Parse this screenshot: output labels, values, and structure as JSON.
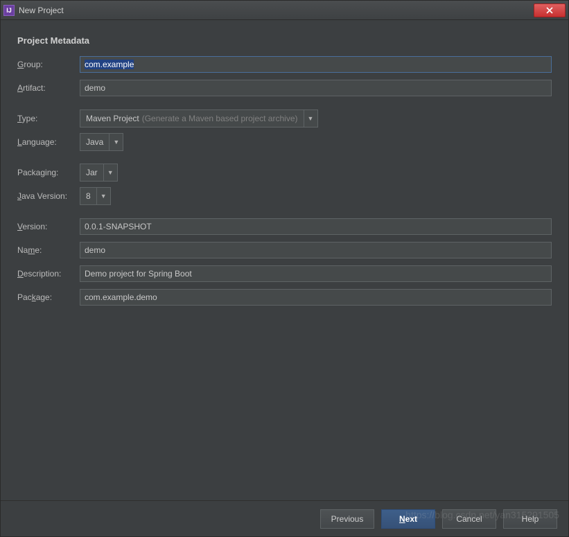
{
  "window": {
    "title": "New Project"
  },
  "section": {
    "title": "Project Metadata"
  },
  "labels": {
    "group": "Group:",
    "artifact": "Artifact:",
    "type": "Type:",
    "language": "Language:",
    "packaging": "Packaging:",
    "javaVersion": "Java Version:",
    "version": "Version:",
    "name": "Name:",
    "description": "Description:",
    "package": "Package:"
  },
  "fields": {
    "group": "com.example",
    "artifact": "demo",
    "type": {
      "value": "Maven Project",
      "hint": "(Generate a Maven based project archive)"
    },
    "language": "Java",
    "packaging": "Jar",
    "javaVersion": "8",
    "version": "0.0.1-SNAPSHOT",
    "name": "demo",
    "description": "Demo project for Spring Boot",
    "package": "com.example.demo"
  },
  "buttons": {
    "previous": "Previous",
    "next": "Next",
    "cancel": "Cancel",
    "help": "Help"
  },
  "watermark": "https://blog.csdn.net/yan315291505"
}
